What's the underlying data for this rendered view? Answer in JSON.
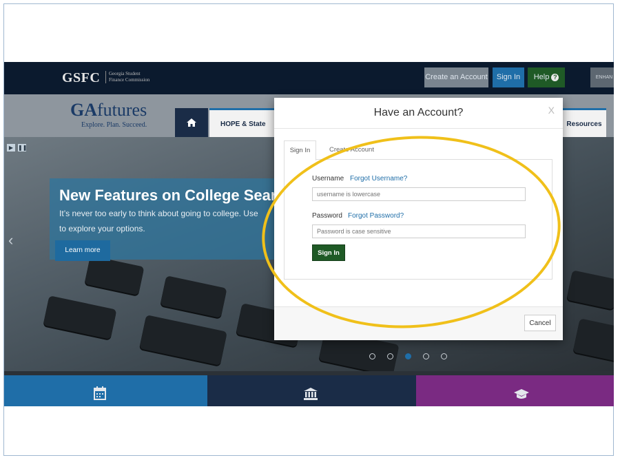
{
  "topbar": {
    "logo": "GSFC",
    "logo_sub_line1": "Georgia Student",
    "logo_sub_line2": "Finance Commission",
    "create_account": "Create an Account",
    "sign_in": "Sign In",
    "help": "Help",
    "enhance": "ENHAN"
  },
  "nav": {
    "logo_ga": "GA",
    "logo_futures": "futures",
    "tagline": "Explore. Plan. Succeed.",
    "home_icon": "home-icon",
    "tab_hope": "HOPE & State Aid",
    "tab_resources": "Resources"
  },
  "hero": {
    "title": "New Features on College Search",
    "text_line1": "It’s never too early to think about going to college. Use",
    "text_line2": "to explore your options.",
    "learn_more": "Learn more",
    "slides": 5,
    "active_slide": 3
  },
  "modal": {
    "title": "Have an Account?",
    "close": "X",
    "tab_signin": "Sign In",
    "tab_create": "Create Account",
    "username_label": "Username",
    "forgot_username": "Forgot Username?",
    "username_placeholder": "username is lowercase",
    "password_label": "Password",
    "forgot_password": "Forgot Password?",
    "password_placeholder": "Password is case sensitive",
    "signin_button": "Sign In",
    "cancel_button": "Cancel"
  },
  "colors": {
    "navy": "#0b1a2e",
    "accent_blue": "#1f6ea8",
    "green": "#1f5a26",
    "purple": "#7a2a82",
    "highlight": "#f0c01a"
  }
}
